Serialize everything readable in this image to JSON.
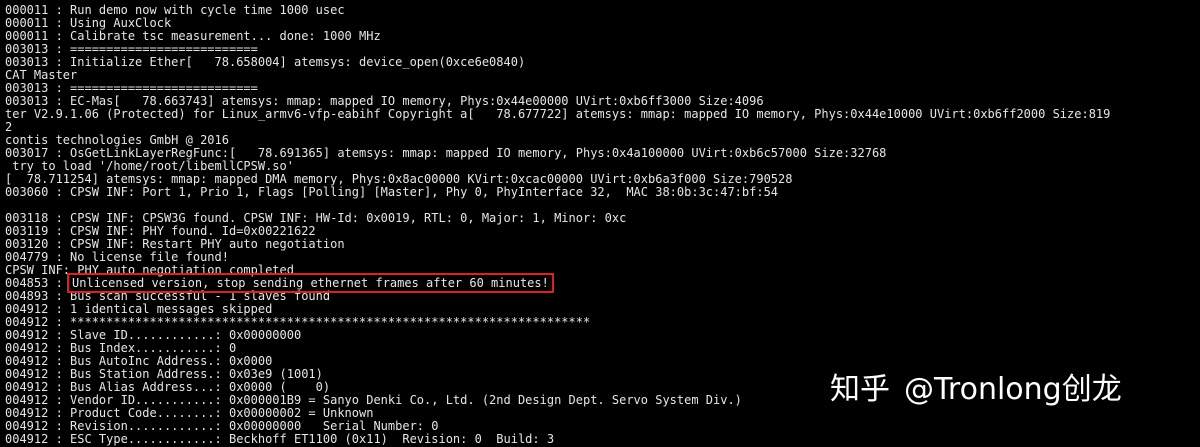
{
  "terminal": {
    "lines": [
      "000011 : Run demo now with cycle time 1000 usec",
      "000011 : Using AuxClock",
      "000011 : Calibrate tsc measurement... done: 1000 MHz",
      "003013 : ==========================",
      "003013 : Initialize Ether[   78.658004] atemsys: device_open(0xce6e0840)",
      "CAT Master",
      "003013 : ==========================",
      "003013 : EC-Mas[   78.663743] atemsys: mmap: mapped IO memory, Phys:0x44e00000 UVirt:0xb6ff3000 Size:4096",
      "ter V2.9.1.06 (Protected) for Linux_armv6-vfp-eabihf Copyright a[   78.677722] atemsys: mmap: mapped IO memory, Phys:0x44e10000 UVirt:0xb6ff2000 Size:819",
      "2",
      "contis technologies GmbH @ 2016",
      "003017 : OsGetLinkLayerRegFunc:[   78.691365] atemsys: mmap: mapped IO memory, Phys:0x4a100000 UVirt:0xb6c57000 Size:32768",
      " try to load '/home/root/libemllCPSW.so'",
      "[  78.711254] atemsys: mmap: mapped DMA memory, Phys:0x8ac00000 KVirt:0xcac00000 UVirt:0xb6a3f000 Size:790528",
      "003060 : CPSW INF: Port 1, Prio 1, Flags [Polling] [Master], Phy 0, PhyInterface 32,  MAC 38:0b:3c:47:bf:54",
      "",
      "003118 : CPSW INF: CPSW3G found. CPSW INF: HW-Id: 0x0019, RTL: 0, Major: 1, Minor: 0xc",
      "003119 : CPSW INF: PHY found. Id=0x00221622",
      "003120 : CPSW INF: Restart PHY auto negotiation",
      "004779 : No license file found!",
      "CPSW INF: PHY auto negotiation completed",
      "004893 : Bus scan successful - 1 slaves found",
      "004912 : 1 identical messages skipped",
      "004912 : ************************************************************************",
      "004912 : Slave ID............: 0x00000000",
      "004912 : Bus Index...........: 0",
      "004912 : Bus AutoInc Address.: 0x0000",
      "004912 : Bus Station Address.: 0x03e9 (1001)",
      "004912 : Bus Alias Address...: 0x0000 (    0)",
      "004912 : Vendor ID...........: 0x000001B9 = Sanyo Denki Co., Ltd. (2nd Design Dept. Servo System Div.)",
      "004912 : Product Code........: 0x00000002 = Unknown",
      "004912 : Revision............: 0x00000000   Serial Number: 0",
      "004912 : ESC Type............: Beckhoff ET1100 (0x11)  Revision: 0  Build: 3"
    ],
    "highlight": {
      "prefix": "004853 : ",
      "text": "Unlicensed version, stop sending ethernet frames after 60 minutes!"
    },
    "highlight_index": 21,
    "text_color": "#e6e6e6",
    "background_color": "#000000",
    "highlight_color": "#e0201e"
  },
  "watermark": {
    "site": "知乎",
    "handle": "@Tronlong创龙"
  }
}
